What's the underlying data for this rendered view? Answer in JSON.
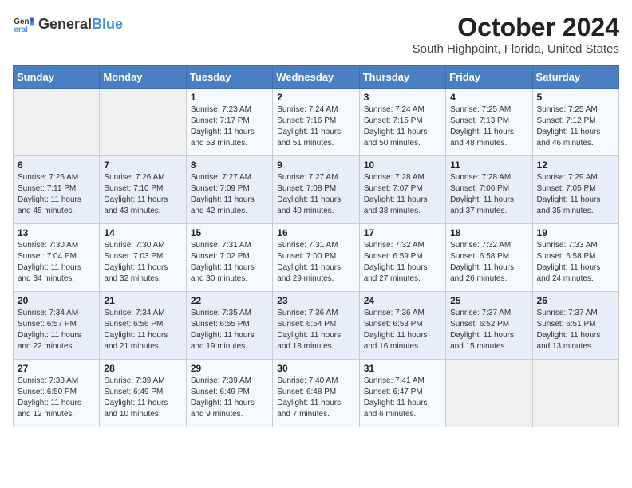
{
  "header": {
    "logo_general": "General",
    "logo_blue": "Blue",
    "month_title": "October 2024",
    "location": "South Highpoint, Florida, United States"
  },
  "weekdays": [
    "Sunday",
    "Monday",
    "Tuesday",
    "Wednesday",
    "Thursday",
    "Friday",
    "Saturday"
  ],
  "weeks": [
    [
      {
        "day": "",
        "content": ""
      },
      {
        "day": "",
        "content": ""
      },
      {
        "day": "1",
        "content": "Sunrise: 7:23 AM\nSunset: 7:17 PM\nDaylight: 11 hours and 53 minutes."
      },
      {
        "day": "2",
        "content": "Sunrise: 7:24 AM\nSunset: 7:16 PM\nDaylight: 11 hours and 51 minutes."
      },
      {
        "day": "3",
        "content": "Sunrise: 7:24 AM\nSunset: 7:15 PM\nDaylight: 11 hours and 50 minutes."
      },
      {
        "day": "4",
        "content": "Sunrise: 7:25 AM\nSunset: 7:13 PM\nDaylight: 11 hours and 48 minutes."
      },
      {
        "day": "5",
        "content": "Sunrise: 7:25 AM\nSunset: 7:12 PM\nDaylight: 11 hours and 46 minutes."
      }
    ],
    [
      {
        "day": "6",
        "content": "Sunrise: 7:26 AM\nSunset: 7:11 PM\nDaylight: 11 hours and 45 minutes."
      },
      {
        "day": "7",
        "content": "Sunrise: 7:26 AM\nSunset: 7:10 PM\nDaylight: 11 hours and 43 minutes."
      },
      {
        "day": "8",
        "content": "Sunrise: 7:27 AM\nSunset: 7:09 PM\nDaylight: 11 hours and 42 minutes."
      },
      {
        "day": "9",
        "content": "Sunrise: 7:27 AM\nSunset: 7:08 PM\nDaylight: 11 hours and 40 minutes."
      },
      {
        "day": "10",
        "content": "Sunrise: 7:28 AM\nSunset: 7:07 PM\nDaylight: 11 hours and 38 minutes."
      },
      {
        "day": "11",
        "content": "Sunrise: 7:28 AM\nSunset: 7:06 PM\nDaylight: 11 hours and 37 minutes."
      },
      {
        "day": "12",
        "content": "Sunrise: 7:29 AM\nSunset: 7:05 PM\nDaylight: 11 hours and 35 minutes."
      }
    ],
    [
      {
        "day": "13",
        "content": "Sunrise: 7:30 AM\nSunset: 7:04 PM\nDaylight: 11 hours and 34 minutes."
      },
      {
        "day": "14",
        "content": "Sunrise: 7:30 AM\nSunset: 7:03 PM\nDaylight: 11 hours and 32 minutes."
      },
      {
        "day": "15",
        "content": "Sunrise: 7:31 AM\nSunset: 7:02 PM\nDaylight: 11 hours and 30 minutes."
      },
      {
        "day": "16",
        "content": "Sunrise: 7:31 AM\nSunset: 7:00 PM\nDaylight: 11 hours and 29 minutes."
      },
      {
        "day": "17",
        "content": "Sunrise: 7:32 AM\nSunset: 6:59 PM\nDaylight: 11 hours and 27 minutes."
      },
      {
        "day": "18",
        "content": "Sunrise: 7:32 AM\nSunset: 6:58 PM\nDaylight: 11 hours and 26 minutes."
      },
      {
        "day": "19",
        "content": "Sunrise: 7:33 AM\nSunset: 6:58 PM\nDaylight: 11 hours and 24 minutes."
      }
    ],
    [
      {
        "day": "20",
        "content": "Sunrise: 7:34 AM\nSunset: 6:57 PM\nDaylight: 11 hours and 22 minutes."
      },
      {
        "day": "21",
        "content": "Sunrise: 7:34 AM\nSunset: 6:56 PM\nDaylight: 11 hours and 21 minutes."
      },
      {
        "day": "22",
        "content": "Sunrise: 7:35 AM\nSunset: 6:55 PM\nDaylight: 11 hours and 19 minutes."
      },
      {
        "day": "23",
        "content": "Sunrise: 7:36 AM\nSunset: 6:54 PM\nDaylight: 11 hours and 18 minutes."
      },
      {
        "day": "24",
        "content": "Sunrise: 7:36 AM\nSunset: 6:53 PM\nDaylight: 11 hours and 16 minutes."
      },
      {
        "day": "25",
        "content": "Sunrise: 7:37 AM\nSunset: 6:52 PM\nDaylight: 11 hours and 15 minutes."
      },
      {
        "day": "26",
        "content": "Sunrise: 7:37 AM\nSunset: 6:51 PM\nDaylight: 11 hours and 13 minutes."
      }
    ],
    [
      {
        "day": "27",
        "content": "Sunrise: 7:38 AM\nSunset: 6:50 PM\nDaylight: 11 hours and 12 minutes."
      },
      {
        "day": "28",
        "content": "Sunrise: 7:39 AM\nSunset: 6:49 PM\nDaylight: 11 hours and 10 minutes."
      },
      {
        "day": "29",
        "content": "Sunrise: 7:39 AM\nSunset: 6:49 PM\nDaylight: 11 hours and 9 minutes."
      },
      {
        "day": "30",
        "content": "Sunrise: 7:40 AM\nSunset: 6:48 PM\nDaylight: 11 hours and 7 minutes."
      },
      {
        "day": "31",
        "content": "Sunrise: 7:41 AM\nSunset: 6:47 PM\nDaylight: 11 hours and 6 minutes."
      },
      {
        "day": "",
        "content": ""
      },
      {
        "day": "",
        "content": ""
      }
    ]
  ]
}
